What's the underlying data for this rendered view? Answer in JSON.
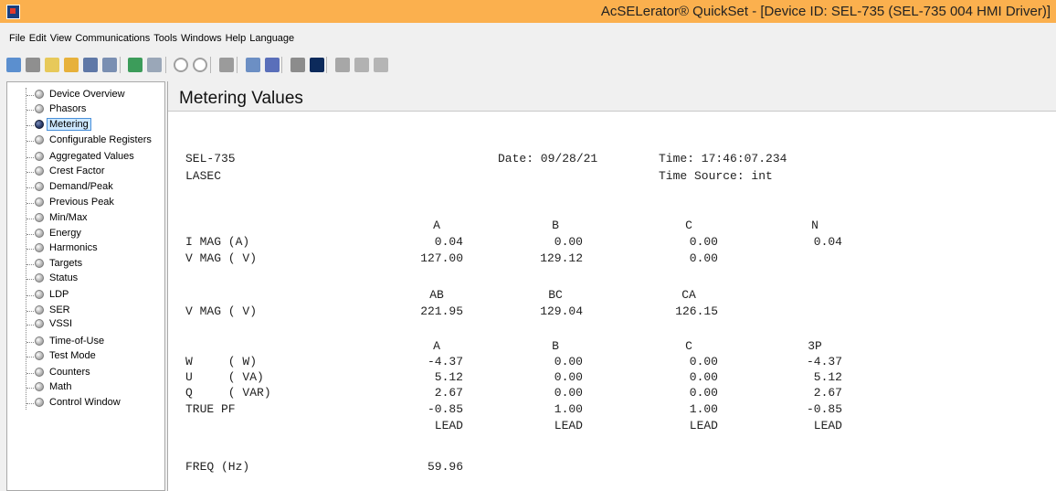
{
  "window": {
    "title": "AcSELerator® QuickSet - [Device ID: SEL-735 (SEL-735 004 HMI Driver)]"
  },
  "menu": [
    "File",
    "Edit",
    "View",
    "Communications",
    "Tools",
    "Windows",
    "Help",
    "Language"
  ],
  "toolbar": {
    "icons": [
      "home-icon",
      "settings-icon",
      "new-file-icon",
      "open-folder-icon",
      "save-icon",
      "save-all-icon",
      "import-icon",
      "export-icon",
      "power-icon",
      "connect-icon",
      "network-icon",
      "wrench-icon",
      "device-icon",
      "gauge-icon",
      "terminal-icon",
      "report-icon",
      "list-icon",
      "gear-icon"
    ]
  },
  "nav": {
    "items": [
      "Device Overview",
      "Phasors",
      "Metering",
      "Configurable Registers",
      "Aggregated Values",
      "Crest Factor",
      "Demand/Peak",
      "Previous Peak",
      "Min/Max",
      "Energy",
      "Harmonics",
      "Targets",
      "Status",
      "LDP",
      "SER",
      "VSSI",
      "Time-of-Use",
      "Test Mode",
      "Counters",
      "Math",
      "Control Window"
    ],
    "selected": "Metering"
  },
  "content": {
    "title": "Metering Values",
    "device": "SEL-735",
    "station": "LASEC",
    "date": "Date: 09/28/21",
    "time": "Time: 17:46:07.234",
    "time_source": "Time Source: int",
    "current_voltage": {
      "headers": [
        "A",
        "B",
        "C",
        "N"
      ],
      "rows": [
        {
          "label": "I MAG (A)",
          "values": [
            "0.04",
            "0.00",
            "0.00",
            "0.04"
          ]
        },
        {
          "label": "V MAG ( V)",
          "values": [
            "127.00",
            "129.12",
            "0.00",
            ""
          ]
        }
      ]
    },
    "line_voltage": {
      "headers": [
        "AB",
        "BC",
        "CA"
      ],
      "rows": [
        {
          "label": "V MAG ( V)",
          "values": [
            "221.95",
            "129.04",
            "126.15"
          ]
        }
      ]
    },
    "power": {
      "headers": [
        "A",
        "B",
        "C",
        "3P"
      ],
      "rows": [
        {
          "label": "W     ( W)",
          "values": [
            "-4.37",
            "0.00",
            "0.00",
            "-4.37"
          ]
        },
        {
          "label": "U     ( VA)",
          "values": [
            "5.12",
            "0.00",
            "0.00",
            "5.12"
          ]
        },
        {
          "label": "Q     ( VAR)",
          "values": [
            "2.67",
            "0.00",
            "0.00",
            "2.67"
          ]
        },
        {
          "label": "TRUE PF",
          "values": [
            "-0.85",
            "1.00",
            "1.00",
            "-0.85"
          ]
        },
        {
          "label": "",
          "values": [
            "LEAD",
            "LEAD",
            "LEAD",
            "LEAD"
          ]
        }
      ]
    },
    "frequency": {
      "label": "FREQ (Hz)",
      "value": "59.96"
    }
  }
}
